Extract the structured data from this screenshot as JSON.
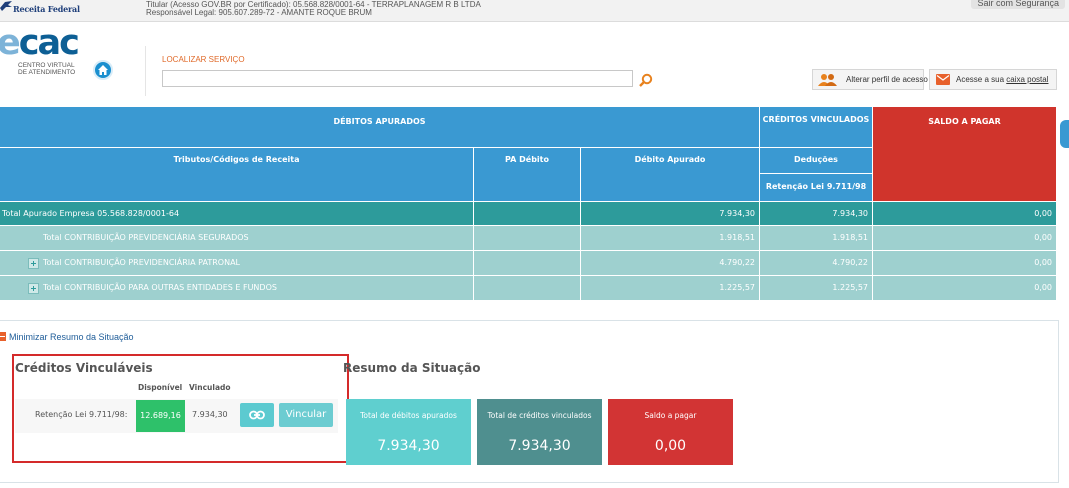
{
  "topbar": {
    "brand": "Receita Federal",
    "titular_line1": "Titular (Acesso GOV.BR por Certificado): 05.568.828/0001-64 - TERRAPLANAGEM R B LTDA",
    "titular_line2": "Responsável Legal: 905.607.289-72 - AMANTE ROQUE BRUM",
    "exit_label": "Sair com Segurança"
  },
  "header": {
    "logo_main": "cac",
    "logo_sub_line1": "CENTRO VIRTUAL",
    "logo_sub_line2": "DE ATENDIMENTO",
    "search_label": "LOCALIZAR SERVIÇO",
    "search_value": "",
    "alterar_perfil": "Alterar perfil de acesso",
    "caixa_prefix": "Acesse a sua ",
    "caixa_link": "caixa postal"
  },
  "table": {
    "debitos_apurados": "DÉBITOS APURADOS",
    "creditos_vinculados": "CRÉDITOS VINCULADOS",
    "saldo_a_pagar": "SALDO A PAGAR",
    "col_tributos": "Tributos/Códigos de Receita",
    "col_pa": "PA Débito",
    "col_debito": "Débito Apurado",
    "col_deducoes": "Deduções",
    "col_retencao": "Retenção Lei 9.711/98",
    "total_row": {
      "label": "Total Apurado Empresa 05.568.828/0001-64",
      "pa": "",
      "debito": "7.934,30",
      "retencao": "7.934,30",
      "saldo": "0,00"
    },
    "rows": [
      {
        "label": "Total CONTRIBUIÇÃO PREVIDENCIÁRIA SEGURADOS",
        "pa": "",
        "debito": "1.918,51",
        "retencao": "1.918,51",
        "saldo": "0,00"
      },
      {
        "label": "Total CONTRIBUIÇÃO PREVIDENCIÁRIA PATRONAL",
        "pa": "",
        "debito": "4.790,22",
        "retencao": "4.790,22",
        "saldo": "0,00"
      },
      {
        "label": "Total CONTRIBUIÇÃO PARA OUTRAS ENTIDADES E FUNDOS",
        "pa": "",
        "debito": "1.225,57",
        "retencao": "1.225,57",
        "saldo": "0,00"
      }
    ]
  },
  "resumo": {
    "minimizar": "Minimizar Resumo da Situação",
    "creditos_title": "Créditos Vinculáveis",
    "col_disponivel": "Disponível",
    "col_vinculado": "Vinculado",
    "retencao_label": "Retenção Lei 9.711/98:",
    "disponivel": "12.689,16",
    "vinculado": "7.934,30",
    "vincular": "Vincular",
    "situacao_title": "Resumo da Situação",
    "cards": [
      {
        "title": "Total de débitos apurados",
        "value": "7.934,30"
      },
      {
        "title": "Total de créditos vinculados",
        "value": "7.934,30"
      },
      {
        "title": "Saldo a pagar",
        "value": "0,00"
      }
    ]
  },
  "colors": {
    "header_blue": "#3a99d2",
    "total_teal": "#2d9b9b",
    "row_teal": "#9ed0cf",
    "saldo_red": "#d0342c",
    "disponivel_green": "#2ec16a"
  },
  "icons": [
    "bird-icon",
    "home-icon",
    "search-icon",
    "users-icon",
    "mail-icon",
    "plus-icon",
    "minus-icon",
    "link-icon"
  ]
}
